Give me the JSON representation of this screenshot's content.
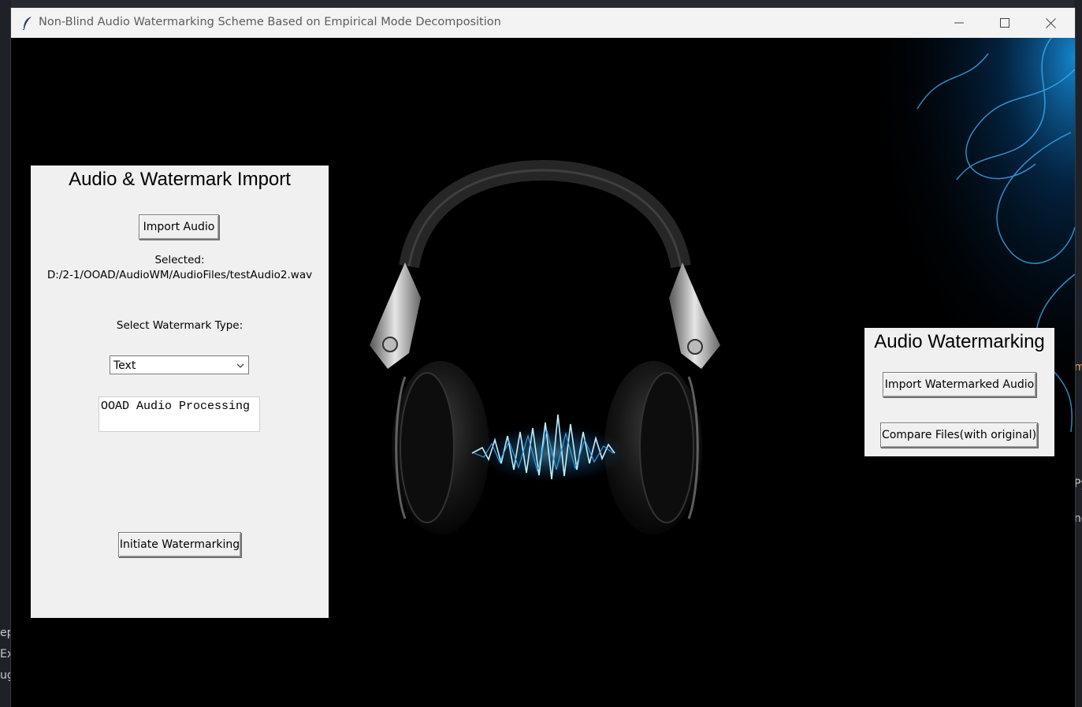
{
  "window": {
    "title": "Non-Blind Audio Watermarking Scheme Based on Empirical Mode Decomposition"
  },
  "import_panel": {
    "heading": "Audio & Watermark Import",
    "import_audio_button": "Import Audio",
    "selected_label": "Selected:",
    "selected_path": "D:/2-1/OOAD/AudioWM/AudioFiles/testAudio2.wav",
    "watermark_type_label": "Select Watermark Type:",
    "watermark_type_value": "Text",
    "watermark_text": "OOAD Audio Processing",
    "initiate_button": "Initiate Watermarking"
  },
  "extraction_panel": {
    "heading": "Audio Watermarking",
    "import_watermarked_button": "Import Watermarked Audio",
    "compare_button": "Compare Files(with original)"
  },
  "desktop_edge": {
    "left_fragments": [
      "ep",
      "Exc",
      "ugi"
    ],
    "right_fragments": [
      "m",
      "Py",
      "nd"
    ]
  },
  "colors": {
    "panel_bg": "#f0f0f0",
    "canvas_bg": "#000000",
    "glow": "#1aa7ff"
  },
  "icons": {
    "app": "feather-icon",
    "minimize": "minimize-icon",
    "maximize": "maximize-icon",
    "close": "close-icon",
    "dropdown": "chevron-down-icon"
  }
}
